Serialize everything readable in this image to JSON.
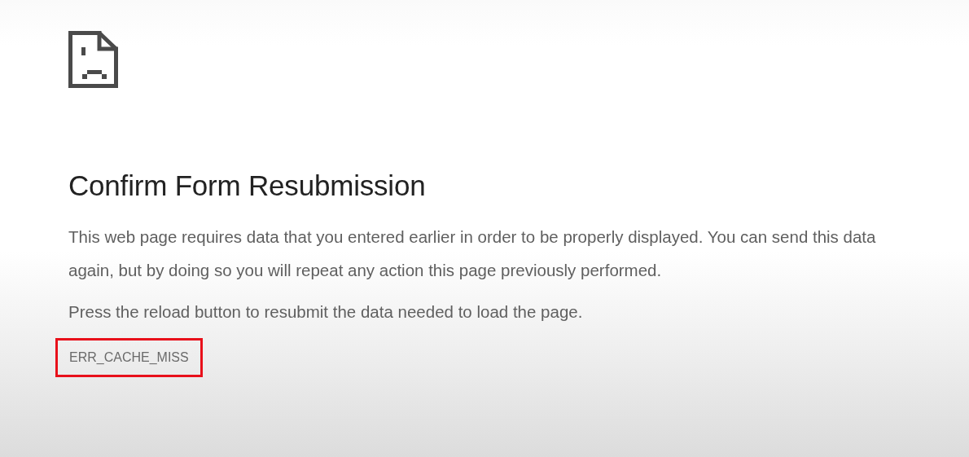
{
  "title": "Confirm Form Resubmission",
  "paragraphs": [
    "This web page requires data that you entered earlier in order to be properly displayed. You can send this data again, but by doing so you will repeat any action this page previously performed.",
    "Press the reload button to resubmit the data needed to load the page."
  ],
  "error_code": {
    "text": "ERR_CACHE_MISS",
    "highlighted": true
  }
}
